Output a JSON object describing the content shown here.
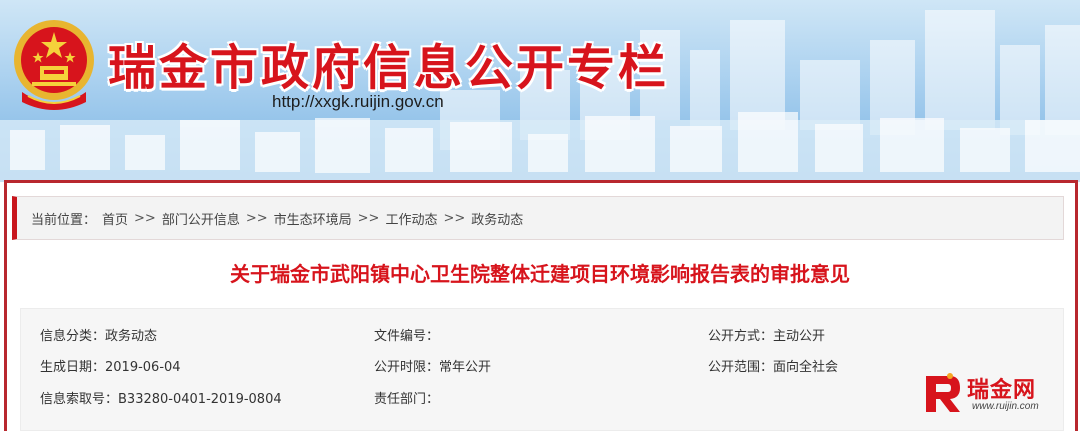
{
  "banner": {
    "title": "瑞金市政府信息公开专栏",
    "url": "http://xxgk.ruijin.gov.cn"
  },
  "breadcrumb": {
    "prefix": "当前位置：",
    "separator": ">>",
    "items": [
      "首页",
      "部门公开信息",
      "市生态环境局",
      "工作动态",
      "政务动态"
    ]
  },
  "document": {
    "title": "关于瑞金市武阳镇中心卫生院整体迁建项目环境影响报告表的审批意见"
  },
  "meta": {
    "category_label": "信息分类：",
    "category_value": "政务动态",
    "doc_no_label": "文件编号：",
    "doc_no_value": "",
    "open_mode_label": "公开方式：",
    "open_mode_value": "主动公开",
    "date_label": "生成日期：",
    "date_value": "2019-06-04",
    "period_label": "公开时限：",
    "period_value": "常年公开",
    "scope_label": "公开范围：",
    "scope_value": "面向全社会",
    "index_label": "信息索取号：",
    "index_value": "B33280-0401-2019-0804",
    "dept_label": "责任部门：",
    "dept_value": ""
  },
  "watermark": {
    "text": "瑞金网",
    "url": "www.ruijin.com"
  },
  "colors": {
    "accent": "#d7141c",
    "frame": "#b8282e",
    "banner_sky": "#a9d0ef"
  }
}
